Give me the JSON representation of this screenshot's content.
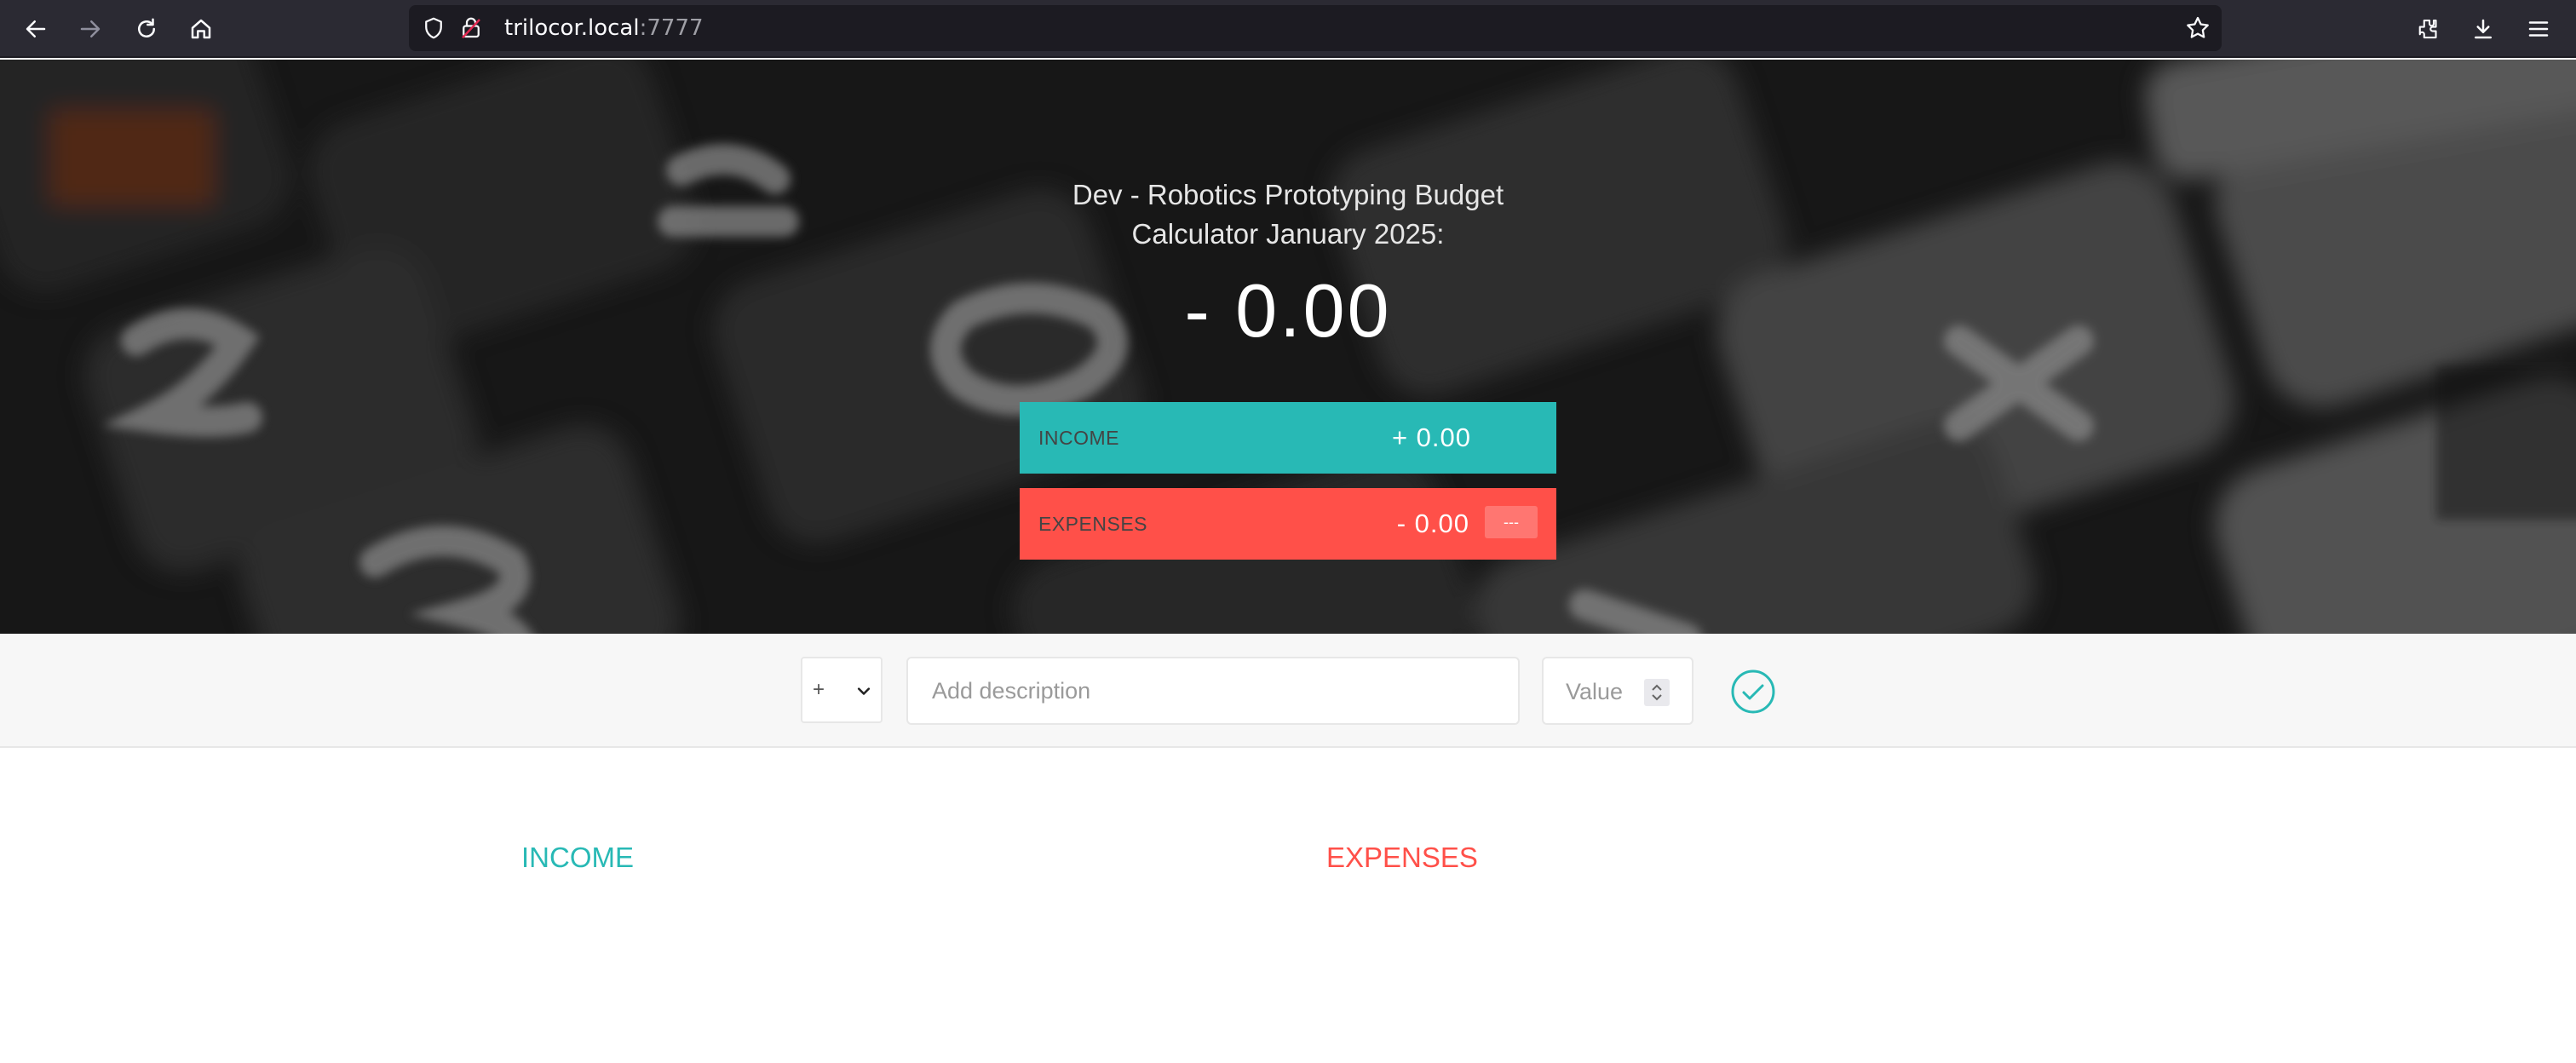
{
  "browser": {
    "url_host": "trilocor.local",
    "url_port": ":7777",
    "icons": [
      "back-icon",
      "forward-icon",
      "reload-icon",
      "home-icon",
      "shield-icon",
      "lock-icon",
      "bookmark-star-icon",
      "extensions-icon",
      "download-icon",
      "menu-icon"
    ]
  },
  "budget": {
    "title": "Dev - Robotics Prototyping Budget Calculator January 2025:",
    "total": "- 0.00",
    "income_label": "INCOME",
    "income_value": "+ 0.00",
    "expenses_label": "EXPENSES",
    "expenses_value": "- 0.00",
    "expenses_percentage": "---"
  },
  "add_form": {
    "type_selected": "+",
    "type_options": [
      "+",
      "-"
    ],
    "description_placeholder": "Add description",
    "value_placeholder": "Value",
    "submit_icon": "checkmark-circle-icon"
  },
  "lists": {
    "income_title": "INCOME",
    "expenses_title": "EXPENSES"
  },
  "colors": {
    "income": "#28b9b5",
    "expenses": "#ff5049",
    "browser_bar": "#2b2a33",
    "url_field": "#1c1b22"
  }
}
